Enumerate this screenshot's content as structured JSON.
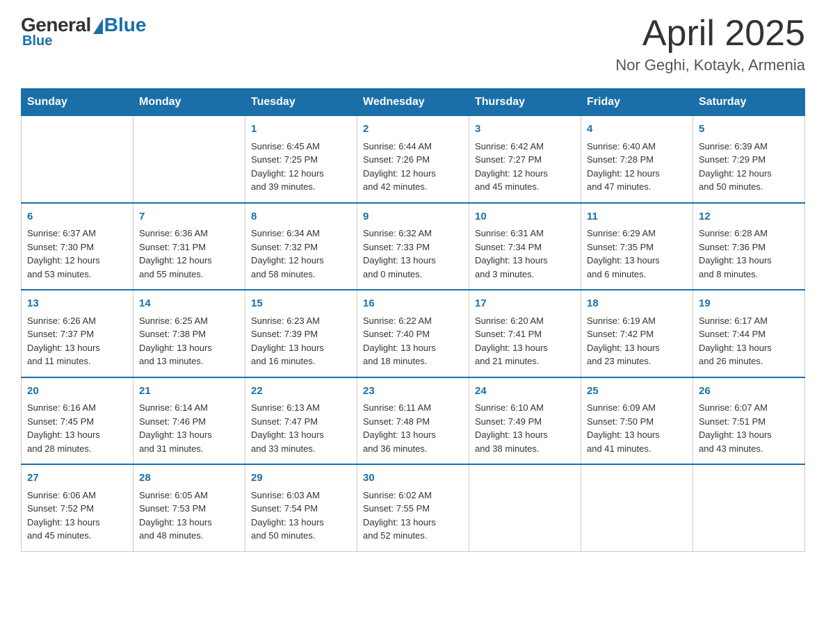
{
  "header": {
    "title": "April 2025",
    "subtitle": "Nor Geghi, Kotayk, Armenia",
    "logo": {
      "general": "General",
      "blue": "Blue"
    }
  },
  "weekdays": [
    "Sunday",
    "Monday",
    "Tuesday",
    "Wednesday",
    "Thursday",
    "Friday",
    "Saturday"
  ],
  "weeks": [
    [
      {
        "day": "",
        "lines": []
      },
      {
        "day": "",
        "lines": []
      },
      {
        "day": "1",
        "lines": [
          "Sunrise: 6:45 AM",
          "Sunset: 7:25 PM",
          "Daylight: 12 hours",
          "and 39 minutes."
        ]
      },
      {
        "day": "2",
        "lines": [
          "Sunrise: 6:44 AM",
          "Sunset: 7:26 PM",
          "Daylight: 12 hours",
          "and 42 minutes."
        ]
      },
      {
        "day": "3",
        "lines": [
          "Sunrise: 6:42 AM",
          "Sunset: 7:27 PM",
          "Daylight: 12 hours",
          "and 45 minutes."
        ]
      },
      {
        "day": "4",
        "lines": [
          "Sunrise: 6:40 AM",
          "Sunset: 7:28 PM",
          "Daylight: 12 hours",
          "and 47 minutes."
        ]
      },
      {
        "day": "5",
        "lines": [
          "Sunrise: 6:39 AM",
          "Sunset: 7:29 PM",
          "Daylight: 12 hours",
          "and 50 minutes."
        ]
      }
    ],
    [
      {
        "day": "6",
        "lines": [
          "Sunrise: 6:37 AM",
          "Sunset: 7:30 PM",
          "Daylight: 12 hours",
          "and 53 minutes."
        ]
      },
      {
        "day": "7",
        "lines": [
          "Sunrise: 6:36 AM",
          "Sunset: 7:31 PM",
          "Daylight: 12 hours",
          "and 55 minutes."
        ]
      },
      {
        "day": "8",
        "lines": [
          "Sunrise: 6:34 AM",
          "Sunset: 7:32 PM",
          "Daylight: 12 hours",
          "and 58 minutes."
        ]
      },
      {
        "day": "9",
        "lines": [
          "Sunrise: 6:32 AM",
          "Sunset: 7:33 PM",
          "Daylight: 13 hours",
          "and 0 minutes."
        ]
      },
      {
        "day": "10",
        "lines": [
          "Sunrise: 6:31 AM",
          "Sunset: 7:34 PM",
          "Daylight: 13 hours",
          "and 3 minutes."
        ]
      },
      {
        "day": "11",
        "lines": [
          "Sunrise: 6:29 AM",
          "Sunset: 7:35 PM",
          "Daylight: 13 hours",
          "and 6 minutes."
        ]
      },
      {
        "day": "12",
        "lines": [
          "Sunrise: 6:28 AM",
          "Sunset: 7:36 PM",
          "Daylight: 13 hours",
          "and 8 minutes."
        ]
      }
    ],
    [
      {
        "day": "13",
        "lines": [
          "Sunrise: 6:26 AM",
          "Sunset: 7:37 PM",
          "Daylight: 13 hours",
          "and 11 minutes."
        ]
      },
      {
        "day": "14",
        "lines": [
          "Sunrise: 6:25 AM",
          "Sunset: 7:38 PM",
          "Daylight: 13 hours",
          "and 13 minutes."
        ]
      },
      {
        "day": "15",
        "lines": [
          "Sunrise: 6:23 AM",
          "Sunset: 7:39 PM",
          "Daylight: 13 hours",
          "and 16 minutes."
        ]
      },
      {
        "day": "16",
        "lines": [
          "Sunrise: 6:22 AM",
          "Sunset: 7:40 PM",
          "Daylight: 13 hours",
          "and 18 minutes."
        ]
      },
      {
        "day": "17",
        "lines": [
          "Sunrise: 6:20 AM",
          "Sunset: 7:41 PM",
          "Daylight: 13 hours",
          "and 21 minutes."
        ]
      },
      {
        "day": "18",
        "lines": [
          "Sunrise: 6:19 AM",
          "Sunset: 7:42 PM",
          "Daylight: 13 hours",
          "and 23 minutes."
        ]
      },
      {
        "day": "19",
        "lines": [
          "Sunrise: 6:17 AM",
          "Sunset: 7:44 PM",
          "Daylight: 13 hours",
          "and 26 minutes."
        ]
      }
    ],
    [
      {
        "day": "20",
        "lines": [
          "Sunrise: 6:16 AM",
          "Sunset: 7:45 PM",
          "Daylight: 13 hours",
          "and 28 minutes."
        ]
      },
      {
        "day": "21",
        "lines": [
          "Sunrise: 6:14 AM",
          "Sunset: 7:46 PM",
          "Daylight: 13 hours",
          "and 31 minutes."
        ]
      },
      {
        "day": "22",
        "lines": [
          "Sunrise: 6:13 AM",
          "Sunset: 7:47 PM",
          "Daylight: 13 hours",
          "and 33 minutes."
        ]
      },
      {
        "day": "23",
        "lines": [
          "Sunrise: 6:11 AM",
          "Sunset: 7:48 PM",
          "Daylight: 13 hours",
          "and 36 minutes."
        ]
      },
      {
        "day": "24",
        "lines": [
          "Sunrise: 6:10 AM",
          "Sunset: 7:49 PM",
          "Daylight: 13 hours",
          "and 38 minutes."
        ]
      },
      {
        "day": "25",
        "lines": [
          "Sunrise: 6:09 AM",
          "Sunset: 7:50 PM",
          "Daylight: 13 hours",
          "and 41 minutes."
        ]
      },
      {
        "day": "26",
        "lines": [
          "Sunrise: 6:07 AM",
          "Sunset: 7:51 PM",
          "Daylight: 13 hours",
          "and 43 minutes."
        ]
      }
    ],
    [
      {
        "day": "27",
        "lines": [
          "Sunrise: 6:06 AM",
          "Sunset: 7:52 PM",
          "Daylight: 13 hours",
          "and 45 minutes."
        ]
      },
      {
        "day": "28",
        "lines": [
          "Sunrise: 6:05 AM",
          "Sunset: 7:53 PM",
          "Daylight: 13 hours",
          "and 48 minutes."
        ]
      },
      {
        "day": "29",
        "lines": [
          "Sunrise: 6:03 AM",
          "Sunset: 7:54 PM",
          "Daylight: 13 hours",
          "and 50 minutes."
        ]
      },
      {
        "day": "30",
        "lines": [
          "Sunrise: 6:02 AM",
          "Sunset: 7:55 PM",
          "Daylight: 13 hours",
          "and 52 minutes."
        ]
      },
      {
        "day": "",
        "lines": []
      },
      {
        "day": "",
        "lines": []
      },
      {
        "day": "",
        "lines": []
      }
    ]
  ]
}
